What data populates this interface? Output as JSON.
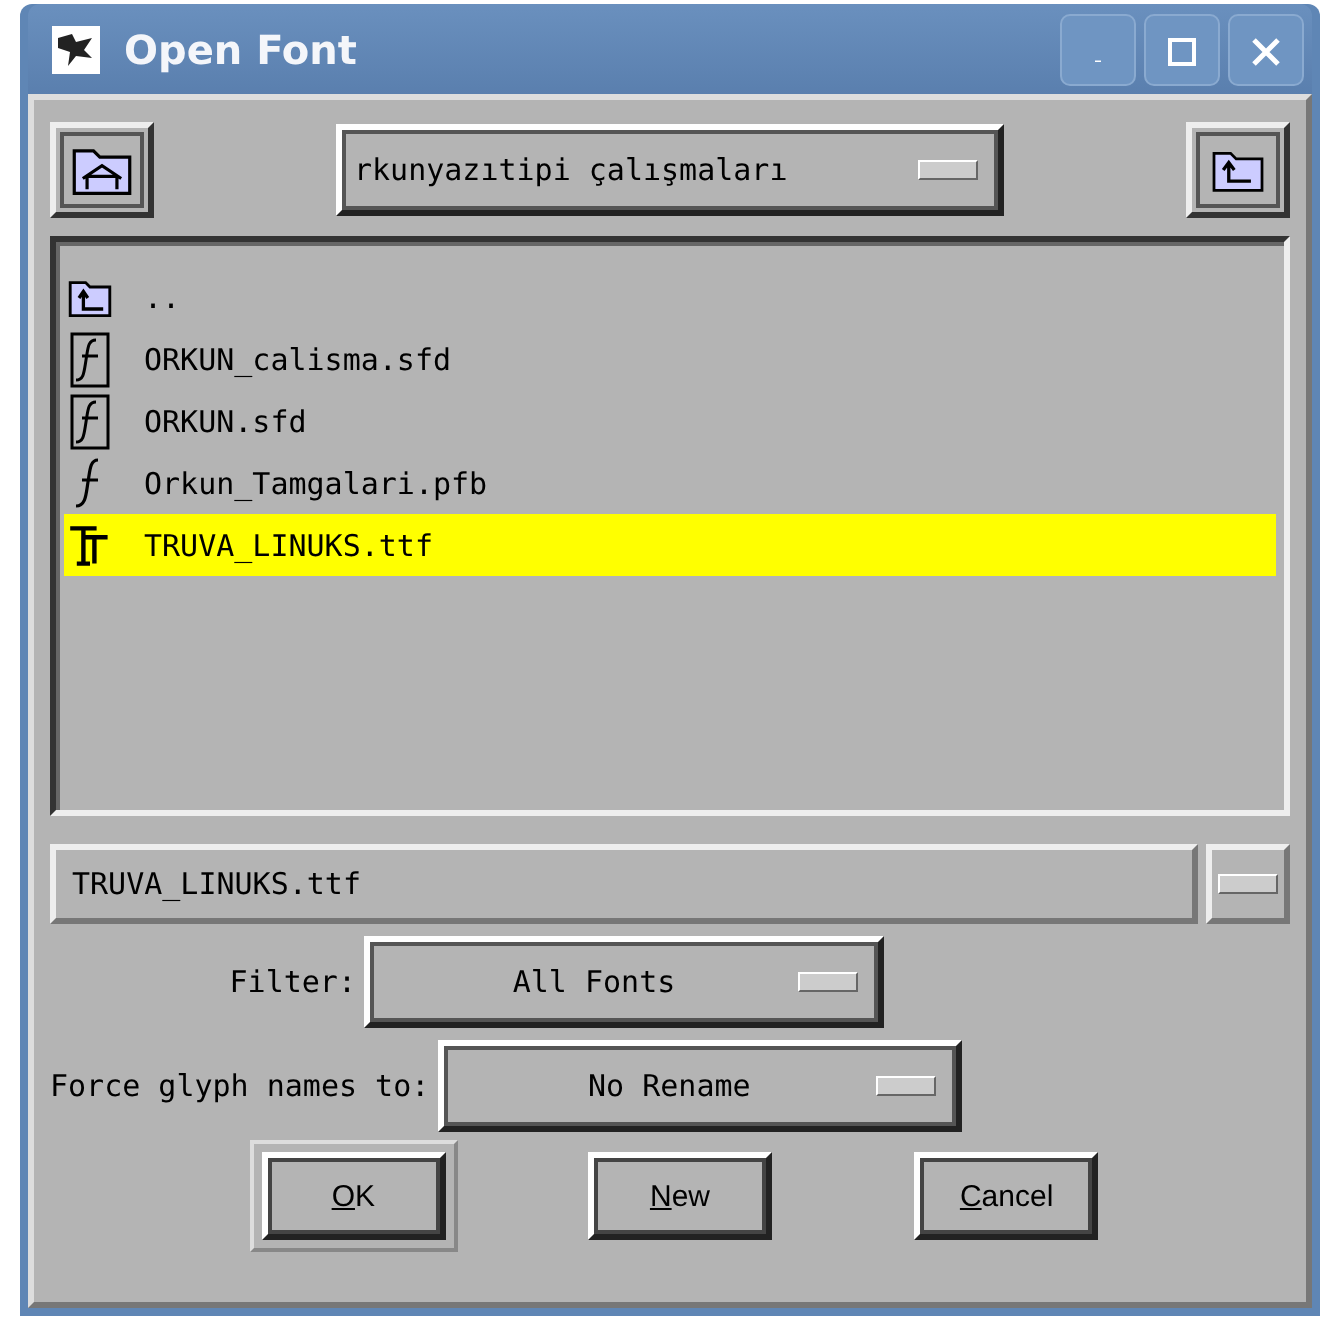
{
  "window": {
    "title": "Open Font"
  },
  "directory": {
    "value": "rkunyazıtipi çalışmaları"
  },
  "files": [
    {
      "kind": "parent",
      "name": "..",
      "selected": false
    },
    {
      "kind": "sfd",
      "name": "ORKUN_calisma.sfd",
      "selected": false
    },
    {
      "kind": "sfd",
      "name": "ORKUN.sfd",
      "selected": false
    },
    {
      "kind": "pfb",
      "name": "Orkun_Tamgalari.pfb",
      "selected": false
    },
    {
      "kind": "ttf",
      "name": "TRUVA_LINUKS.ttf",
      "selected": true
    }
  ],
  "filename": {
    "value": "TRUVA_LINUKS.ttf"
  },
  "filter": {
    "label": "Filter:",
    "value": "All Fonts"
  },
  "rename": {
    "label": "Force glyph names to:",
    "value": "No Rename"
  },
  "buttons": [
    {
      "label": "OK",
      "default": true,
      "mnemonic_underlined": true
    },
    {
      "label": "New",
      "default": false,
      "mnemonic_underlined": true
    },
    {
      "label": "Cancel",
      "default": false,
      "mnemonic_underlined": true
    }
  ]
}
